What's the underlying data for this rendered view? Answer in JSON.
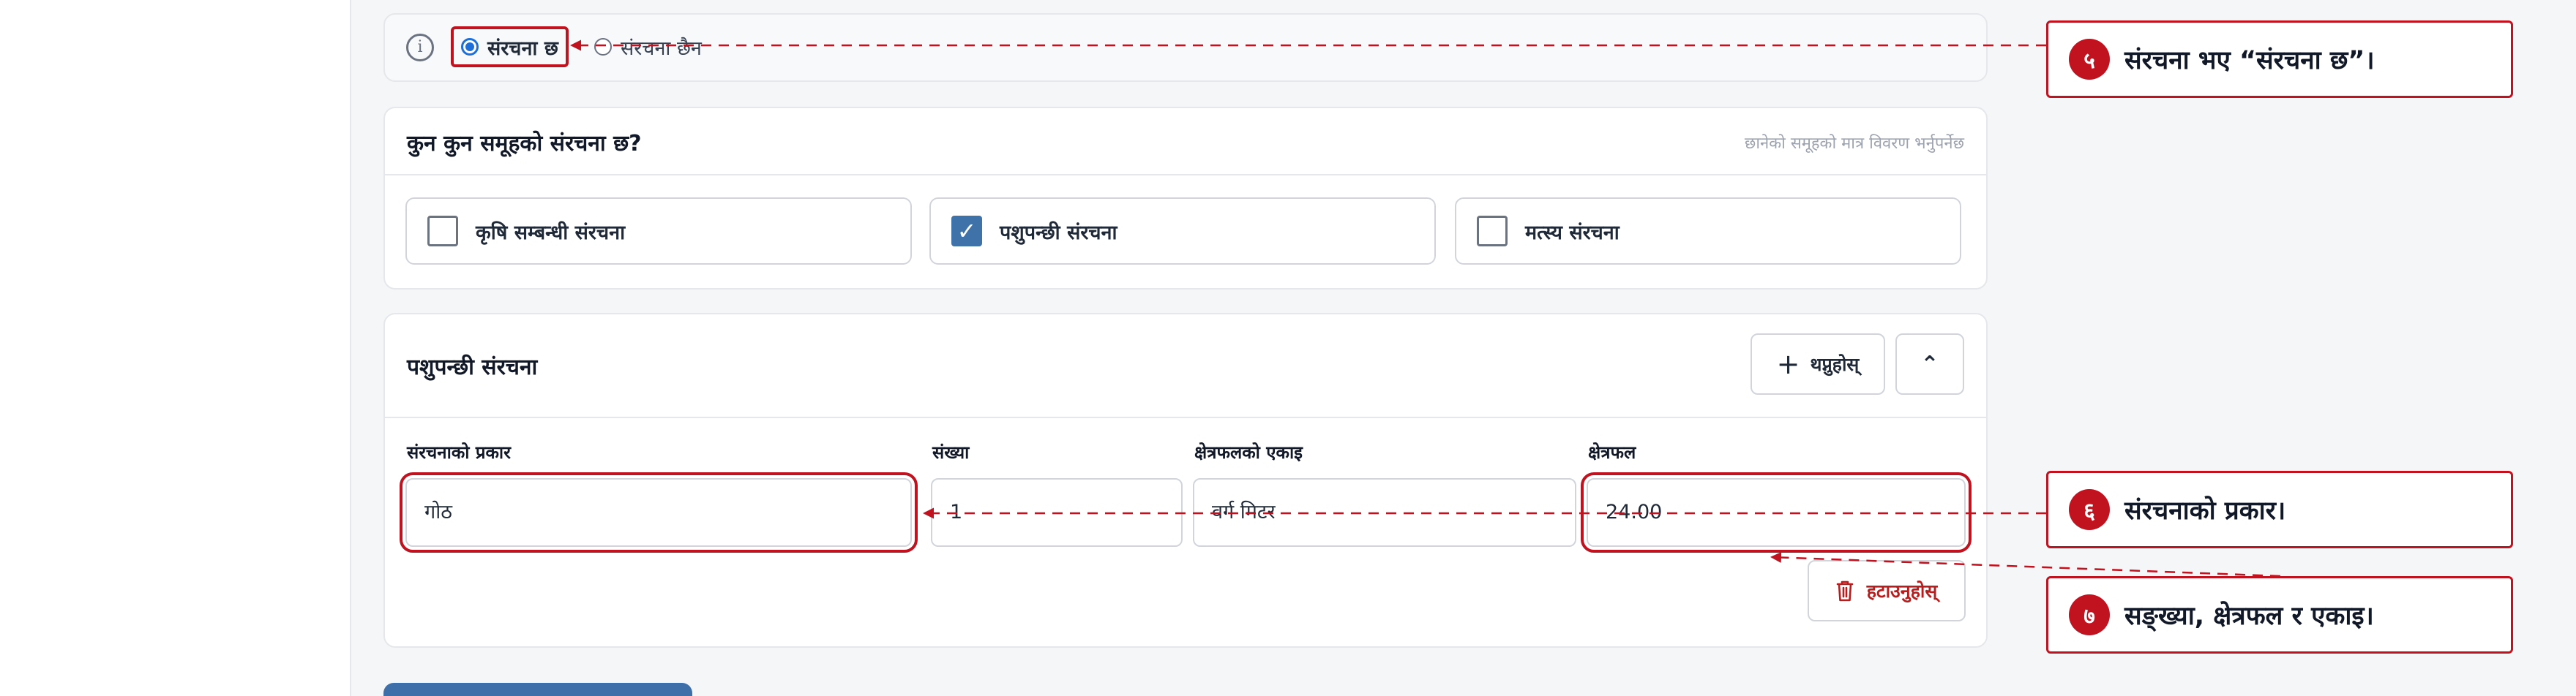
{
  "structure_section": {
    "options": [
      {
        "label": "संरचना छ",
        "selected": true
      },
      {
        "label": "संरचना छैन",
        "selected": false
      }
    ]
  },
  "groups_card": {
    "title": "कुन कुन समूहको संरचना छ?",
    "note": "छानेको समूहको मात्र विवरण भर्नुपर्नेछ",
    "checkboxes": [
      {
        "label": "कृषि सम्बन्धी संरचना",
        "checked": false
      },
      {
        "label": "पशुपन्छी संरचना",
        "checked": true
      },
      {
        "label": "मत्स्य संरचना",
        "checked": false
      }
    ]
  },
  "livestock_card": {
    "title": "पशुपन्छी संरचना",
    "add_label": "थप्नुहोस्",
    "delete_label": "हटाउनुहोस्",
    "fields": {
      "type_label": "संरचनाको प्रकार",
      "type_value": "गोठ",
      "count_label": "संख्या",
      "count_value": "1",
      "unit_label": "क्षेत्रफलको एकाइ",
      "unit_value": "वर्ग मिटर",
      "area_label": "क्षेत्रफल",
      "area_value": "24.00"
    }
  },
  "annotations": [
    {
      "number": "५",
      "text": "संरचना भए “संरचना छ”।"
    },
    {
      "number": "६",
      "text": "संरचनाको प्रकार।"
    },
    {
      "number": "७",
      "text": "सङ्ख्या, क्षेत्रफल र एकाइ।"
    }
  ],
  "icons": {
    "check": "✓",
    "plus": "+",
    "chevron_up": "⌃"
  },
  "colors": {
    "accent": "#c1121f",
    "primary": "#3f72a8",
    "radio": "#1d70d9"
  }
}
